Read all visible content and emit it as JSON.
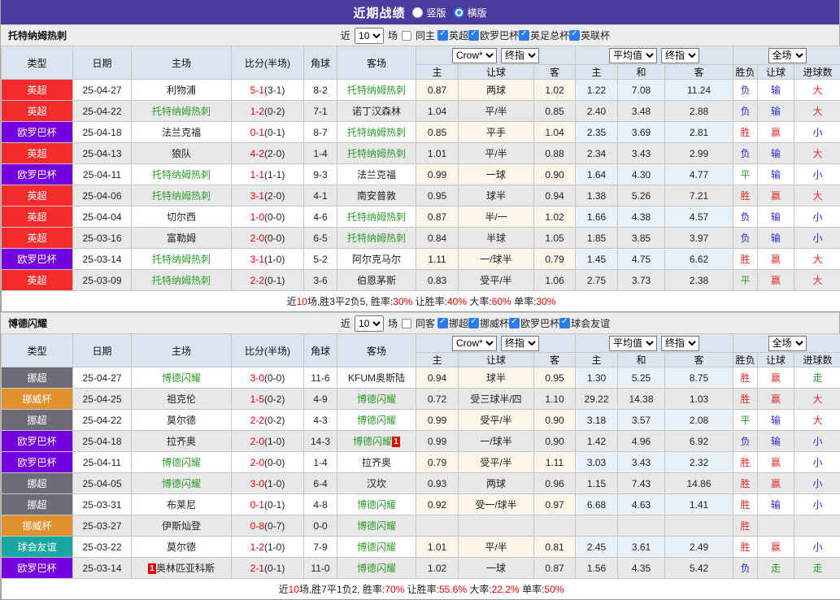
{
  "title_bar": {
    "title": "近期战绩",
    "radios": [
      {
        "label": "竖版",
        "checked": false
      },
      {
        "label": "横版",
        "checked": true
      }
    ]
  },
  "colors": {
    "topbar": "#4a3c9e",
    "checkbox_blue": "#2b7cf0",
    "focus_team_green": "#2d9b2d",
    "score_red": "#e60000",
    "league": {
      "英超": "#f62b2b",
      "欧罗巴杯": "#7400e0",
      "挪超": "#6e6d77",
      "挪威杯": "#e0912e",
      "球会友谊": "#17a8a1"
    },
    "result_class": {
      "胜": "red",
      "平": "green",
      "负": "blue",
      "赢": "red",
      "输": "blue",
      "走": "green",
      "大": "red",
      "小": "blue"
    }
  },
  "table_header": {
    "main_cols": [
      "类型",
      "日期",
      "主场",
      "比分(半场)",
      "角球",
      "客场"
    ],
    "selects": {
      "crow": "Crow*",
      "final1": "终指",
      "avg": "平均值",
      "final2": "终指",
      "full": "全场"
    },
    "sub_cols": [
      "主",
      "让球",
      "客",
      "主",
      "和",
      "客",
      "胜负",
      "让球",
      "进球数"
    ]
  },
  "sections": [
    {
      "team": "托特纳姆热刺",
      "filter": {
        "near": "近",
        "count": "10",
        "matches": "场",
        "same": "同主",
        "leagues": [
          "英超",
          "欧罗巴杯",
          "英足总杯",
          "英联杯"
        ]
      },
      "rows": [
        {
          "league": "英超",
          "date": "25-04-27",
          "home": "利物浦",
          "home_focus": false,
          "home_card": "",
          "score": "5-1",
          "half": "(3-1)",
          "corner": "8-2",
          "away": "托特纳姆热刺",
          "away_focus": true,
          "away_card": "",
          "odds": [
            "0.87",
            "两球",
            "1.02"
          ],
          "avg": [
            "1.22",
            "7.08",
            "11.24"
          ],
          "results": [
            "负",
            "输",
            "大"
          ]
        },
        {
          "league": "英超",
          "date": "25-04-22",
          "home": "托特纳姆热刺",
          "home_focus": true,
          "home_card": "",
          "score": "1-2",
          "half": "(0-2)",
          "corner": "7-1",
          "away": "诺丁汉森林",
          "away_focus": false,
          "away_card": "",
          "odds": [
            "1.04",
            "平/半",
            "0.85"
          ],
          "avg": [
            "2.40",
            "3.48",
            "2.88"
          ],
          "results": [
            "负",
            "输",
            "大"
          ]
        },
        {
          "league": "欧罗巴杯",
          "date": "25-04-18",
          "home": "法兰克福",
          "home_focus": false,
          "home_card": "",
          "score": "0-1",
          "half": "(0-1)",
          "corner": "8-7",
          "away": "托特纳姆热刺",
          "away_focus": true,
          "away_card": "",
          "odds": [
            "0.85",
            "平手",
            "1.04"
          ],
          "avg": [
            "2.35",
            "3.69",
            "2.81"
          ],
          "results": [
            "胜",
            "赢",
            "小"
          ]
        },
        {
          "league": "英超",
          "date": "25-04-13",
          "home": "狼队",
          "home_focus": false,
          "home_card": "",
          "score": "4-2",
          "half": "(2-0)",
          "corner": "1-4",
          "away": "托特纳姆热刺",
          "away_focus": true,
          "away_card": "",
          "odds": [
            "1.01",
            "平/半",
            "0.88"
          ],
          "avg": [
            "2.34",
            "3.43",
            "2.99"
          ],
          "results": [
            "负",
            "输",
            "大"
          ]
        },
        {
          "league": "欧罗巴杯",
          "date": "25-04-11",
          "home": "托特纳姆热刺",
          "home_focus": true,
          "home_card": "",
          "score": "1-1",
          "half": "(1-1)",
          "corner": "9-3",
          "away": "法兰克福",
          "away_focus": false,
          "away_card": "",
          "odds": [
            "0.99",
            "一球",
            "0.90"
          ],
          "avg": [
            "1.64",
            "4.30",
            "4.77"
          ],
          "results": [
            "平",
            "输",
            "小"
          ]
        },
        {
          "league": "英超",
          "date": "25-04-06",
          "home": "托特纳姆热刺",
          "home_focus": true,
          "home_card": "",
          "score": "3-1",
          "half": "(2-0)",
          "corner": "4-1",
          "away": "南安普敦",
          "away_focus": false,
          "away_card": "",
          "odds": [
            "0.95",
            "球半",
            "0.94"
          ],
          "avg": [
            "1.38",
            "5.26",
            "7.21"
          ],
          "results": [
            "胜",
            "赢",
            "大"
          ]
        },
        {
          "league": "英超",
          "date": "25-04-04",
          "home": "切尔西",
          "home_focus": false,
          "home_card": "",
          "score": "1-0",
          "half": "(0-0)",
          "corner": "4-6",
          "away": "托特纳姆热刺",
          "away_focus": true,
          "away_card": "",
          "odds": [
            "0.87",
            "半/一",
            "1.02"
          ],
          "avg": [
            "1.66",
            "4.38",
            "4.57"
          ],
          "results": [
            "负",
            "输",
            "小"
          ]
        },
        {
          "league": "英超",
          "date": "25-03-16",
          "home": "富勒姆",
          "home_focus": false,
          "home_card": "",
          "score": "2-0",
          "half": "(0-0)",
          "corner": "6-5",
          "away": "托特纳姆热刺",
          "away_focus": true,
          "away_card": "",
          "odds": [
            "0.84",
            "半球",
            "1.05"
          ],
          "avg": [
            "1.85",
            "3.85",
            "3.97"
          ],
          "results": [
            "负",
            "输",
            "小"
          ]
        },
        {
          "league": "欧罗巴杯",
          "date": "25-03-14",
          "home": "托特纳姆热刺",
          "home_focus": true,
          "home_card": "",
          "score": "3-1",
          "half": "(1-0)",
          "corner": "5-2",
          "away": "阿尔克马尔",
          "away_focus": false,
          "away_card": "",
          "odds": [
            "1.11",
            "一/球半",
            "0.79"
          ],
          "avg": [
            "1.45",
            "4.75",
            "6.62"
          ],
          "results": [
            "胜",
            "赢",
            "大"
          ]
        },
        {
          "league": "英超",
          "date": "25-03-09",
          "home": "托特纳姆热刺",
          "home_focus": true,
          "home_card": "",
          "score": "2-2",
          "half": "(0-1)",
          "corner": "3-6",
          "away": "伯恩茅斯",
          "away_focus": false,
          "away_card": "",
          "odds": [
            "0.83",
            "受平/半",
            "1.06"
          ],
          "avg": [
            "2.75",
            "3.73",
            "2.38"
          ],
          "results": [
            "平",
            "赢",
            "大"
          ]
        }
      ],
      "summary": [
        {
          "t": "近"
        },
        {
          "t": "10",
          "r": true
        },
        {
          "t": "场,胜3平2负5, 胜率:"
        },
        {
          "t": "30%",
          "r": true
        },
        {
          "t": " 让胜率:"
        },
        {
          "t": "40%",
          "r": true
        },
        {
          "t": " 大率:"
        },
        {
          "t": "60%",
          "r": true
        },
        {
          "t": " 单率:"
        },
        {
          "t": "30%",
          "r": true
        }
      ]
    },
    {
      "team": "博德闪耀",
      "filter": {
        "near": "近",
        "count": "10",
        "matches": "场",
        "same": "同客",
        "leagues": [
          "挪超",
          "挪威杯",
          "欧罗巴杯",
          "球会友谊"
        ]
      },
      "rows": [
        {
          "league": "挪超",
          "date": "25-04-27",
          "home": "博德闪耀",
          "home_focus": true,
          "home_card": "",
          "score": "3-0",
          "half": "(0-0)",
          "corner": "11-6",
          "away": "KFUM奥斯陆",
          "away_focus": false,
          "away_card": "",
          "odds": [
            "0.94",
            "球半",
            "0.95"
          ],
          "avg": [
            "1.30",
            "5.25",
            "8.75"
          ],
          "results": [
            "胜",
            "赢",
            "走"
          ]
        },
        {
          "league": "挪威杯",
          "date": "25-04-25",
          "home": "祖克伦",
          "home_focus": false,
          "home_card": "",
          "score": "1-5",
          "half": "(0-2)",
          "corner": "4-9",
          "away": "博德闪耀",
          "away_focus": true,
          "away_card": "",
          "odds": [
            "0.72",
            "受三球半/四",
            "1.10"
          ],
          "avg": [
            "29.22",
            "14.38",
            "1.03"
          ],
          "results": [
            "胜",
            "赢",
            "大"
          ]
        },
        {
          "league": "挪超",
          "date": "25-04-22",
          "home": "莫尔德",
          "home_focus": false,
          "home_card": "",
          "score": "2-2",
          "half": "(0-2)",
          "corner": "4-3",
          "away": "博德闪耀",
          "away_focus": true,
          "away_card": "",
          "odds": [
            "0.99",
            "受平/半",
            "0.90"
          ],
          "avg": [
            "3.18",
            "3.57",
            "2.08"
          ],
          "results": [
            "平",
            "输",
            "大"
          ]
        },
        {
          "league": "欧罗巴杯",
          "date": "25-04-18",
          "home": "拉齐奥",
          "home_focus": false,
          "home_card": "",
          "score": "2-0",
          "half": "(1-0)",
          "corner": "14-3",
          "away": "博德闪耀",
          "away_focus": true,
          "away_card": "1",
          "odds": [
            "0.99",
            "一/球半",
            "0.90"
          ],
          "avg": [
            "1.42",
            "4.96",
            "6.92"
          ],
          "results": [
            "负",
            "输",
            "小"
          ]
        },
        {
          "league": "欧罗巴杯",
          "date": "25-04-11",
          "home": "博德闪耀",
          "home_focus": true,
          "home_card": "",
          "score": "2-0",
          "half": "(0-0)",
          "corner": "1-4",
          "away": "拉齐奥",
          "away_focus": false,
          "away_card": "",
          "odds": [
            "0.79",
            "受平/半",
            "1.11"
          ],
          "avg": [
            "3.03",
            "3.43",
            "2.32"
          ],
          "results": [
            "胜",
            "赢",
            "小"
          ]
        },
        {
          "league": "挪超",
          "date": "25-04-05",
          "home": "博德闪耀",
          "home_focus": true,
          "home_card": "",
          "score": "3-0",
          "half": "(1-0)",
          "corner": "6-4",
          "away": "汉坎",
          "away_focus": false,
          "away_card": "",
          "odds": [
            "0.93",
            "两球",
            "0.96"
          ],
          "avg": [
            "1.15",
            "7.43",
            "14.86"
          ],
          "results": [
            "胜",
            "赢",
            "小"
          ]
        },
        {
          "league": "挪超",
          "date": "25-03-31",
          "home": "布莱尼",
          "home_focus": false,
          "home_card": "",
          "score": "0-1",
          "half": "(0-1)",
          "corner": "4-8",
          "away": "博德闪耀",
          "away_focus": true,
          "away_card": "",
          "odds": [
            "0.92",
            "受一/球半",
            "0.97"
          ],
          "avg": [
            "6.68",
            "4.63",
            "1.41"
          ],
          "results": [
            "胜",
            "输",
            "小"
          ]
        },
        {
          "league": "挪威杯",
          "date": "25-03-27",
          "home": "伊斯灿登",
          "home_focus": false,
          "home_card": "",
          "score": "0-8",
          "half": "(0-7)",
          "corner": "0-0",
          "away": "博德闪耀",
          "away_focus": true,
          "away_card": "",
          "odds": [
            "",
            "",
            ""
          ],
          "avg": [
            "",
            "",
            ""
          ],
          "results": [
            "胜",
            "",
            ""
          ]
        },
        {
          "league": "球会友谊",
          "date": "25-03-22",
          "home": "莫尔德",
          "home_focus": false,
          "home_card": "",
          "score": "1-2",
          "half": "(1-0)",
          "corner": "7-9",
          "away": "博德闪耀",
          "away_focus": true,
          "away_card": "",
          "odds": [
            "1.01",
            "平/半",
            "0.81"
          ],
          "avg": [
            "2.45",
            "3.61",
            "2.49"
          ],
          "results": [
            "胜",
            "赢",
            "小"
          ]
        },
        {
          "league": "欧罗巴杯",
          "date": "25-03-14",
          "home": "奥林匹亚科斯",
          "home_focus": false,
          "home_card": "1",
          "score": "2-1",
          "half": "(0-1)",
          "corner": "11-0",
          "away": "博德闪耀",
          "away_focus": true,
          "away_card": "",
          "odds": [
            "1.02",
            "一球",
            "0.87"
          ],
          "avg": [
            "1.56",
            "4.35",
            "5.42"
          ],
          "results": [
            "负",
            "走",
            "走"
          ]
        }
      ],
      "summary": [
        {
          "t": "近"
        },
        {
          "t": "10",
          "r": true
        },
        {
          "t": "场,胜7平1负2, 胜率:"
        },
        {
          "t": "70%",
          "r": true
        },
        {
          "t": " 让胜率:"
        },
        {
          "t": "55.6%",
          "r": true
        },
        {
          "t": " 大率:"
        },
        {
          "t": "22.2%",
          "r": true
        },
        {
          "t": " 单率:"
        },
        {
          "t": "50%",
          "r": true
        }
      ]
    }
  ]
}
